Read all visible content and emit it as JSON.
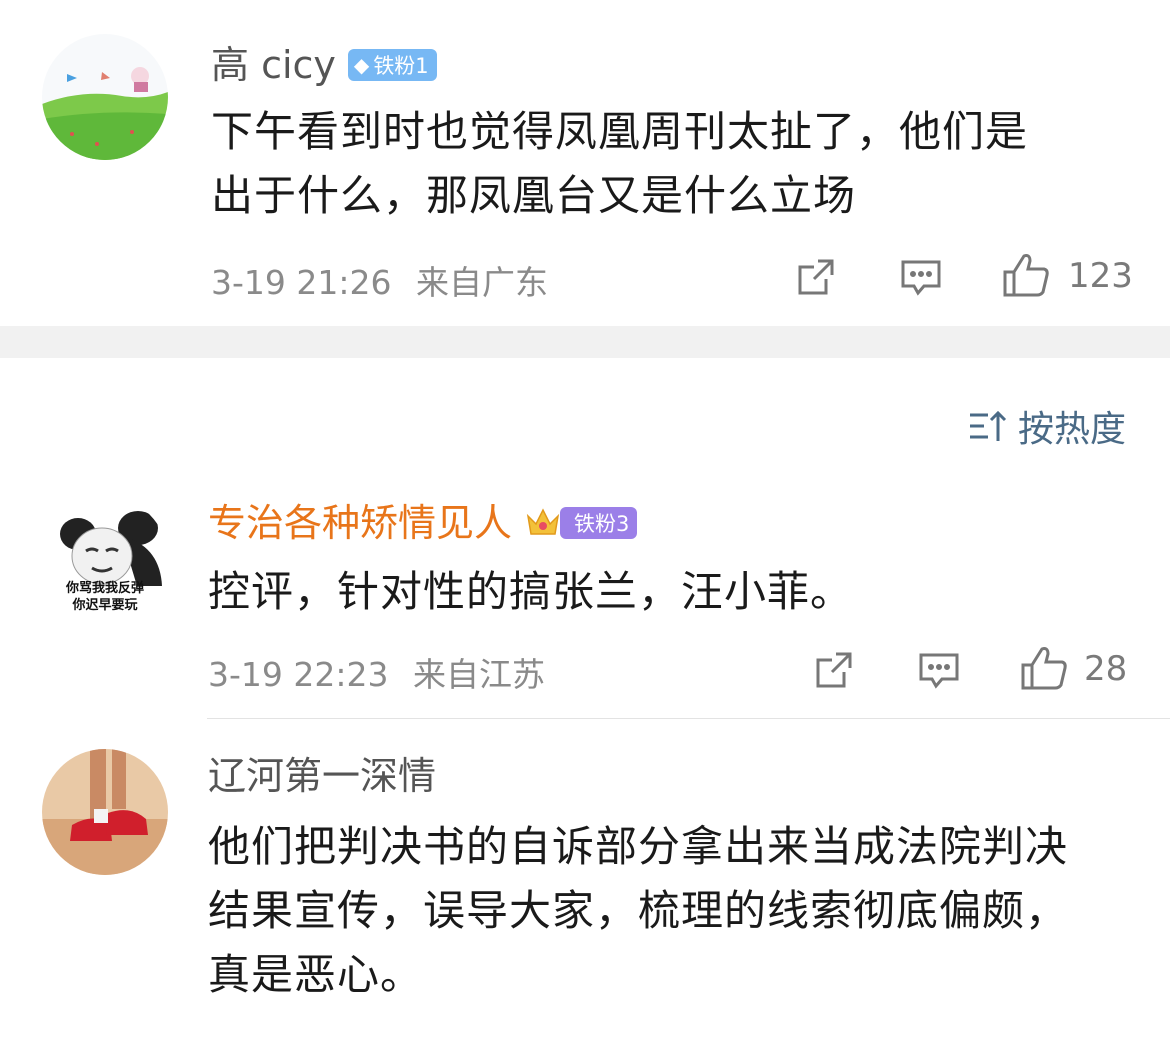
{
  "comments": [
    {
      "username": "高 cicy",
      "badge": "铁粉1",
      "text_lines": [
        "下午看到时也觉得凤凰周刊太扯了，他们是",
        "出于什么，那凤凰台又是什么立场"
      ],
      "time": "3-19 21:26",
      "location": "来自广东",
      "likes": "123",
      "avatar_icon": "grass-sky-avatar"
    },
    {
      "username": "专治各种矫情见人",
      "badge": "铁粉3",
      "text_lines": [
        "控评，针对性的搞张兰，汪小菲。"
      ],
      "time": "3-19 22:23",
      "location": "来自江苏",
      "likes": "28",
      "avatar_icon": "panda-meme-avatar",
      "avatar_caption_1": "你骂我我反弹",
      "avatar_caption_2": "你迟早要玩"
    },
    {
      "username": "辽河第一深情",
      "text_lines": [
        "他们把判决书的自诉部分拿出来当成法院判决",
        "结果宣传，误导大家，梳理的线索彻底偏颇，",
        "真是恶心。"
      ],
      "avatar_icon": "red-sneakers-avatar"
    }
  ],
  "sort_label": "按热度",
  "colors": {
    "username_default": "#555555",
    "username_highlight": "#e8751a",
    "badge_blue": "#77b8f4",
    "badge_purple": "#9b7fe8",
    "sort_text": "#4a6a86"
  }
}
